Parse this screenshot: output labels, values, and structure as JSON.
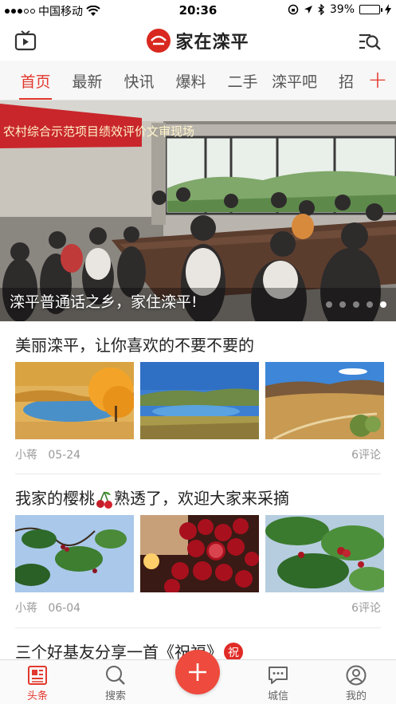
{
  "status_bar": {
    "carrier": "中国移动",
    "time": "20:36",
    "battery": "39%",
    "battery_level": 0.39
  },
  "header": {
    "app_name": "家在滦平",
    "brand_color": "#d9281f"
  },
  "tabs": {
    "items": [
      "首页",
      "最新",
      "快讯",
      "爆料",
      "二手",
      "滦平吧",
      "招"
    ],
    "active_index": 0,
    "active_color": "#e2382d"
  },
  "banner": {
    "caption": "滦平普通话之乡，家住滦平!",
    "slide_count": 5,
    "active_slide": 4,
    "sign_text": "农村综合示范项目绩效评价文审现场"
  },
  "articles": [
    {
      "title": "美丽滦平，让你喜欢的不要不要的",
      "author": "小蒋",
      "date": "05-24",
      "comments": "6评论",
      "thumbnails": [
        "autumn-lake-photo",
        "lake-blue-sky-photo",
        "hills-road-photo"
      ]
    },
    {
      "title_before": "我家的樱桃",
      "title_after": "熟透了，欢迎大家来采摘",
      "author": "小蒋",
      "date": "06-04",
      "comments": "6评论",
      "thumbnails": [
        "cherry-tree-photo",
        "cherry-bowl-photo",
        "cherry-branch-photo"
      ]
    },
    {
      "title": "三个好基友分享一首《祝福》",
      "badge": "祝"
    }
  ],
  "bottom_nav": {
    "items": [
      {
        "label": "头条",
        "icon": "newspaper-icon"
      },
      {
        "label": "搜索",
        "icon": "search-icon"
      },
      {
        "label": "城信",
        "icon": "chat-icon"
      },
      {
        "label": "我的",
        "icon": "profile-icon"
      }
    ],
    "active_index": 0,
    "fab_icon": "plus-icon"
  }
}
